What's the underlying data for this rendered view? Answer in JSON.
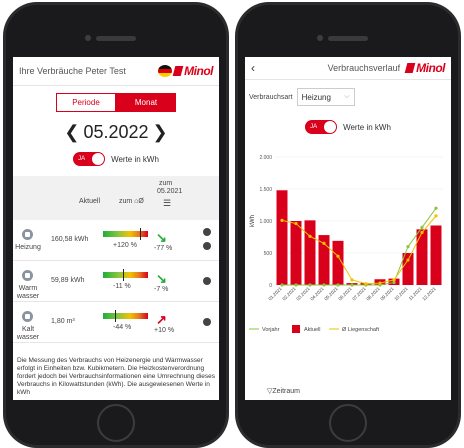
{
  "screen1": {
    "header_title": "Ihre Verbräuche Peter Test",
    "brand": "Minol",
    "tabs": [
      "Periode",
      "Monat"
    ],
    "period": "05.2022",
    "prev_arrow": "❮",
    "next_arrow": "❯",
    "toggle_on_label": "JA",
    "toggle_label": "Werte in kWh",
    "columns": {
      "aktuell": "Aktuell",
      "zum": "zum ⌂Ø",
      "zum2": "zum",
      "prev_period": "05.2021"
    },
    "rows": [
      {
        "name": "Heizung",
        "value": "160,58 kWh",
        "pct_avg": "+120 %",
        "pct_prev": "-77 %",
        "trend": "↘",
        "trend_color": "#1fae3a"
      },
      {
        "name": "Warm wasser",
        "value": "59,89 kWh",
        "pct_avg": "-11 %",
        "pct_prev": "-7 %",
        "trend": "↘",
        "trend_color": "#1fae3a"
      },
      {
        "name": "Kalt wasser",
        "value": "1,80 m³",
        "pct_avg": "-44 %",
        "pct_prev": "+10 %",
        "trend": "↗",
        "trend_color": "#d9001b"
      }
    ],
    "note": "Die Messung des Verbrauchs von Heizenergie und Warmwasser erfolgt in Einheiten bzw. Kubikmetern. Die Heizkostenverordnung fordert jedoch bei Verbrauchsinformationen eine Umrechnung dieses Verbrauchs in Kilowattstunden (kWh). Die ausgewiesenen Werte in kWh"
  },
  "screen2": {
    "back": "‹",
    "header_title": "Verbrauchsverlauf",
    "brand": "Minol",
    "select_label": "Verbrauchsart",
    "select_value": "Heizung",
    "toggle_on_label": "JA",
    "toggle_label": "Werte in kWh",
    "legend": [
      "Vorjahr",
      "Aktuell",
      "Ø Liegenschaft"
    ],
    "zeitraum_label": "Zeitraum",
    "colors": {
      "aktuell": "#d9001b",
      "vorjahr": "#8cc63f",
      "avg": "#f2c200"
    }
  },
  "chart_data": {
    "type": "bar",
    "ylabel": "kWh",
    "ylim": [
      0,
      2000
    ],
    "yticks": [
      "0",
      "500",
      "1.000",
      "1.500",
      "2.000"
    ],
    "categories": [
      "01.2021",
      "02.2021",
      "03.2021",
      "04.2021",
      "05.2021",
      "06.2021",
      "07.2021",
      "08.2021",
      "09.2021",
      "10.2021",
      "11.2021",
      "12.2021"
    ],
    "series": [
      {
        "name": "Aktuell",
        "kind": "bar",
        "values": [
          1480,
          1000,
          1010,
          780,
          690,
          30,
          30,
          90,
          100,
          500,
          870,
          930
        ]
      },
      {
        "name": "Ø Liegenschaft",
        "kind": "line",
        "values": [
          1010,
          960,
          760,
          650,
          450,
          80,
          20,
          30,
          80,
          390,
          820,
          1080
        ]
      },
      {
        "name": "Vorjahr",
        "kind": "line",
        "values": [
          0,
          0,
          0,
          0,
          0,
          0,
          0,
          0,
          40,
          600,
          900,
          1200
        ]
      }
    ]
  }
}
